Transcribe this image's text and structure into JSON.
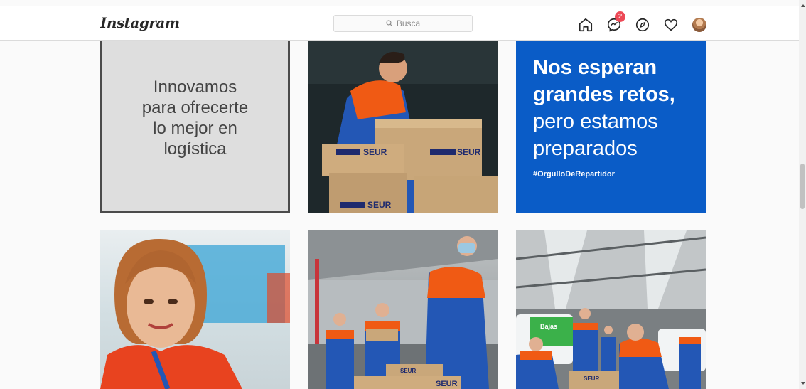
{
  "header": {
    "logo": "Instagram",
    "search_placeholder": "Busca",
    "notifications_badge": "2"
  },
  "posts": [
    {
      "text_lines": [
        "Innovamos",
        "para ofrecerte",
        "lo mejor en",
        "logística"
      ]
    },
    {
      "box_labels": [
        "SEUR",
        "SEUR",
        "SEUR"
      ]
    },
    {
      "headline_bold": [
        "Nos esperan",
        "grandes retos,"
      ],
      "headline_regular": [
        "pero estamos",
        "preparados"
      ],
      "hashtag": "#OrgulloDeRepartidor"
    },
    {},
    {
      "box_labels": [
        "SEUR",
        "SEUR"
      ]
    },
    {
      "box_labels": [
        "SEUR"
      ],
      "van_label": "Bajas"
    }
  ],
  "colors": {
    "seur_blue": "#0a5cc7",
    "seur_orange": "#f05a14",
    "badge_red": "#ed4956"
  }
}
